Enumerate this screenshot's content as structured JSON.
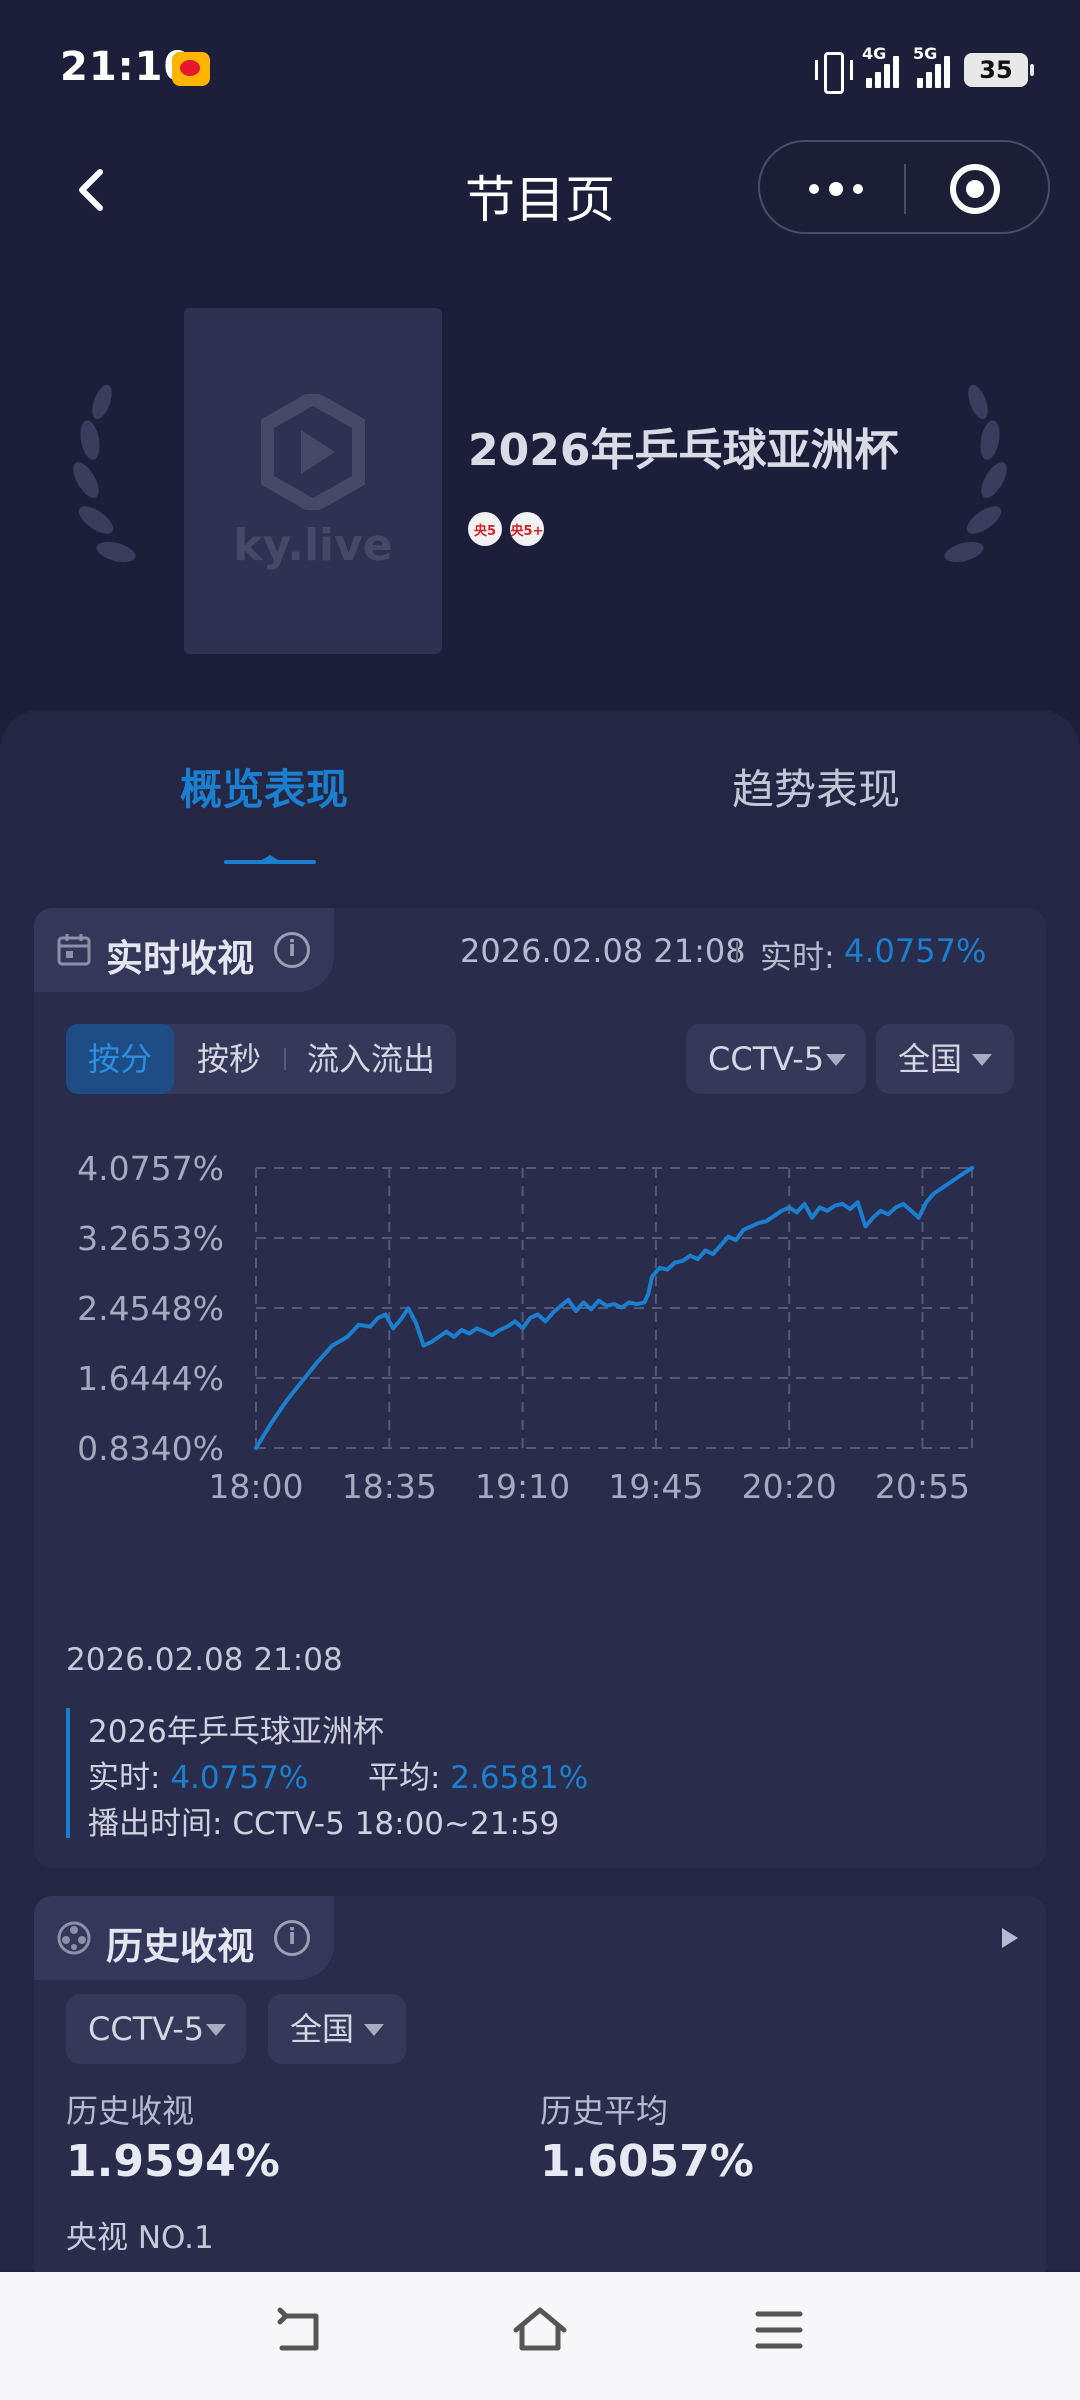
{
  "status_bar": {
    "time": "21:10",
    "network_1": "4G",
    "network_2": "5G",
    "battery": "35"
  },
  "header": {
    "title": "节目页"
  },
  "program": {
    "poster_logo_text": "ky.live",
    "name": "2026年乒乓球亚洲杯",
    "channels": [
      "央5",
      "央5+"
    ]
  },
  "tabs": [
    {
      "label": "概览表现",
      "active": true
    },
    {
      "label": "趋势表现",
      "active": false
    }
  ],
  "realtime": {
    "title": "实时收视",
    "info": "i",
    "timestamp": "2026.02.08 21:08",
    "label": "实时:",
    "value": "4.0757%",
    "segments": [
      "按分",
      "按秒",
      "流入流出"
    ],
    "channel_select": "CCTV-5",
    "region_select": "全国",
    "hover_date": "2026.02.08 21:08",
    "legend": {
      "program": "2026年乒乓球亚洲杯",
      "realtime_label": "实时:",
      "realtime_value": "4.0757%",
      "average_label": "平均:",
      "average_value": "2.6581%",
      "airtime_label": "播出时间:",
      "airtime_value": "CCTV-5 18:00~21:59"
    }
  },
  "history": {
    "title": "历史收视",
    "info": "i",
    "channel_select": "CCTV-5",
    "region_select": "全国",
    "history_rating_label": "历史收视",
    "history_rating_value": "1.9594%",
    "history_avg_label": "历史平均",
    "history_avg_value": "1.6057%",
    "rank": "央视 NO.1"
  },
  "chart_data": {
    "type": "line",
    "x_ticks": [
      "18:00",
      "18:35",
      "19:10",
      "19:45",
      "20:20",
      "20:55"
    ],
    "y_ticks": [
      "0.8340%",
      "1.6444%",
      "2.4548%",
      "3.2653%",
      "4.0757%"
    ],
    "ylim": [
      0.834,
      4.0757
    ],
    "x_range_minutes": [
      0,
      188
    ],
    "grid": true,
    "line_color": "#1b7fd0",
    "series": [
      {
        "x": [
          0,
          4,
          8,
          12,
          16,
          20,
          24,
          27,
          30,
          32,
          34,
          36,
          38,
          40,
          42,
          44,
          46,
          48,
          50,
          52,
          54,
          56,
          58,
          60,
          62,
          64,
          66,
          68,
          70,
          72,
          74,
          76,
          78,
          80,
          82,
          84,
          86,
          88,
          90,
          92,
          94,
          96,
          98,
          100,
          102,
          103,
          104,
          106,
          108,
          110,
          112,
          114,
          116,
          118,
          120,
          122,
          124,
          126,
          128,
          130,
          132,
          134,
          136,
          138,
          140,
          142,
          144,
          146,
          148,
          150,
          152,
          154,
          156,
          158,
          160,
          162,
          164,
          166,
          168,
          170,
          172,
          174,
          176,
          178,
          180,
          182,
          184,
          186,
          188
        ],
        "y": [
          0.834,
          1.12,
          1.38,
          1.6,
          1.82,
          2.02,
          2.12,
          2.26,
          2.24,
          2.34,
          2.38,
          2.22,
          2.32,
          2.45,
          2.28,
          2.02,
          2.06,
          2.12,
          2.18,
          2.12,
          2.2,
          2.16,
          2.22,
          2.18,
          2.14,
          2.2,
          2.24,
          2.3,
          2.22,
          2.34,
          2.38,
          2.3,
          2.4,
          2.48,
          2.55,
          2.42,
          2.52,
          2.44,
          2.54,
          2.48,
          2.5,
          2.46,
          2.52,
          2.5,
          2.52,
          2.62,
          2.82,
          2.92,
          2.9,
          2.98,
          3.0,
          3.06,
          3.02,
          3.12,
          3.08,
          3.18,
          3.28,
          3.24,
          3.36,
          3.4,
          3.44,
          3.46,
          3.52,
          3.58,
          3.62,
          3.56,
          3.66,
          3.5,
          3.62,
          3.58,
          3.64,
          3.66,
          3.6,
          3.68,
          3.4,
          3.5,
          3.58,
          3.54,
          3.62,
          3.66,
          3.58,
          3.5,
          3.68,
          3.78,
          3.84,
          3.9,
          3.96,
          4.02,
          4.0757
        ]
      }
    ]
  }
}
